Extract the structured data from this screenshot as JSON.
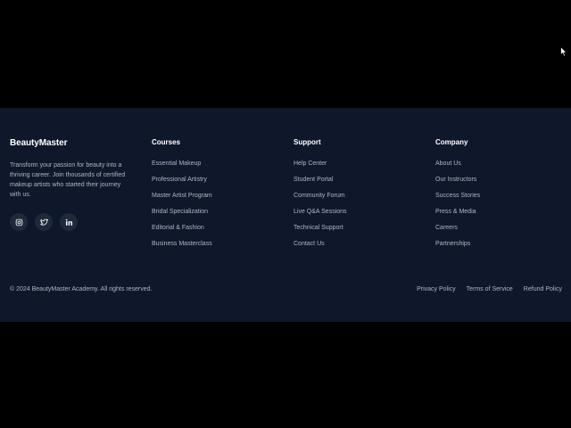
{
  "brand": {
    "name": "BeautyMaster",
    "description": "Transform your passion for beauty into a thriving career. Join thousands of certified makeup artists who started their journey with us."
  },
  "socials": [
    {
      "icon": "instagram-icon"
    },
    {
      "icon": "twitter-icon"
    },
    {
      "icon": "linkedin-icon"
    }
  ],
  "courses": {
    "title": "Courses",
    "items": [
      "Essential Makeup",
      "Professional Artistry",
      "Master Artist Program",
      "Bridal Specialization",
      "Editorial & Fashion",
      "Business Masterclass"
    ]
  },
  "support": {
    "title": "Support",
    "items": [
      "Help Center",
      "Student Portal",
      "Community Forum",
      "Live Q&A Sessions",
      "Technical Support",
      "Contact Us"
    ]
  },
  "company": {
    "title": "Company",
    "items": [
      "About Us",
      "Our Instructors",
      "Success Stories",
      "Press & Media",
      "Careers",
      "Partnerships"
    ]
  },
  "bottom": {
    "copyright": "© 2024 BeautyMaster Academy. All rights reserved.",
    "links": [
      "Privacy Policy",
      "Terms of Service",
      "Refund Policy"
    ]
  },
  "colors": {
    "footer_bg": "#0f172a",
    "social_bg": "#1e293b",
    "text_muted": "#aeb6c4",
    "text_heading": "#ffffff"
  }
}
